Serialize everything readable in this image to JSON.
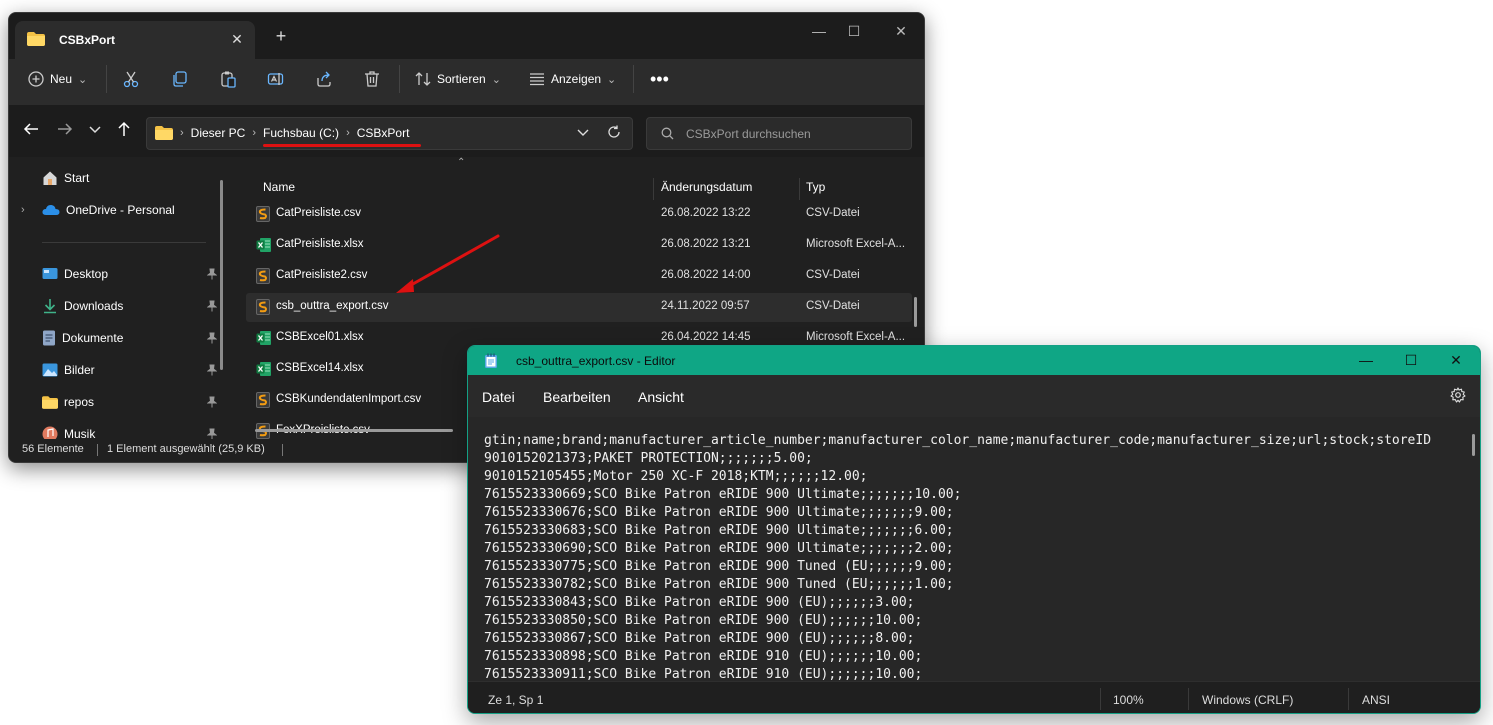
{
  "explorer": {
    "tab_title": "CSBxPort",
    "toolbar": {
      "new_label": "Neu",
      "sort_label": "Sortieren",
      "view_label": "Anzeigen"
    },
    "address": {
      "crumbs": [
        "Dieser PC",
        "Fuchsbau (C:)",
        "CSBxPort"
      ]
    },
    "search": {
      "placeholder": "CSBxPort durchsuchen"
    },
    "sidebar": {
      "items": [
        {
          "label": "Start",
          "icon": "home-icon"
        },
        {
          "label": "OneDrive - Personal",
          "icon": "cloud-icon"
        },
        {
          "label": "Desktop",
          "icon": "desktop-icon"
        },
        {
          "label": "Downloads",
          "icon": "download-icon"
        },
        {
          "label": "Dokumente",
          "icon": "document-icon"
        },
        {
          "label": "Bilder",
          "icon": "picture-icon"
        },
        {
          "label": "repos",
          "icon": "folder-icon"
        },
        {
          "label": "Musik",
          "icon": "music-icon"
        }
      ]
    },
    "columns": {
      "name": "Name",
      "date": "Änderungsdatum",
      "type": "Typ"
    },
    "files": [
      {
        "name": "CatPreisliste.csv",
        "date": "26.08.2022 13:22",
        "type": "CSV-Datei",
        "icon": "csv-icon"
      },
      {
        "name": "CatPreisliste.xlsx",
        "date": "26.08.2022 13:21",
        "type": "Microsoft Excel-A...",
        "icon": "excel-icon"
      },
      {
        "name": "CatPreisliste2.csv",
        "date": "26.08.2022 14:00",
        "type": "CSV-Datei",
        "icon": "csv-icon"
      },
      {
        "name": "csb_outtra_export.csv",
        "date": "24.11.2022 09:57",
        "type": "CSV-Datei",
        "icon": "csv-icon"
      },
      {
        "name": "CSBExcel01.xlsx",
        "date": "26.04.2022 14:45",
        "type": "Microsoft Excel-A...",
        "icon": "excel-icon"
      },
      {
        "name": "CSBExcel14.xlsx",
        "date": "",
        "type": "",
        "icon": "excel-icon"
      },
      {
        "name": "CSBKundendatenImport.csv",
        "date": "",
        "type": "",
        "icon": "csv-icon"
      },
      {
        "name": "FoxXPreisliste.csv",
        "date": "",
        "type": "",
        "icon": "csv-icon"
      }
    ],
    "status": {
      "count": "56 Elemente",
      "selection": "1 Element ausgewählt (25,9 KB)"
    }
  },
  "notepad": {
    "title": "csb_outtra_export.csv - Editor",
    "menu": [
      "Datei",
      "Bearbeiten",
      "Ansicht"
    ],
    "lines": [
      "gtin;name;brand;manufacturer_article_number;manufacturer_color_name;manufacturer_code;manufacturer_size;url;stock;storeID",
      "9010152021373;PAKET PROTECTION;;;;;;;5.00;",
      "9010152105455;Motor 250 XC-F 2018;KTM;;;;;;12.00;",
      "7615523330669;SCO Bike Patron eRIDE 900 Ultimate;;;;;;;10.00;",
      "7615523330676;SCO Bike Patron eRIDE 900 Ultimate;;;;;;;9.00;",
      "7615523330683;SCO Bike Patron eRIDE 900 Ultimate;;;;;;;6.00;",
      "7615523330690;SCO Bike Patron eRIDE 900 Ultimate;;;;;;;2.00;",
      "7615523330775;SCO Bike Patron eRIDE 900 Tuned (EU;;;;;;9.00;",
      "7615523330782;SCO Bike Patron eRIDE 900 Tuned (EU;;;;;;1.00;",
      "7615523330843;SCO Bike Patron eRIDE 900 (EU);;;;;;3.00;",
      "7615523330850;SCO Bike Patron eRIDE 900 (EU);;;;;;10.00;",
      "7615523330867;SCO Bike Patron eRIDE 900 (EU);;;;;;8.00;",
      "7615523330898;SCO Bike Patron eRIDE 910 (EU);;;;;;10.00;",
      "7615523330911;SCO Bike Patron eRIDE 910 (EU);;;;;;10.00;"
    ],
    "status": {
      "position": "Ze 1, Sp 1",
      "zoom": "100%",
      "line_ending": "Windows (CRLF)",
      "encoding": "ANSI"
    }
  },
  "colors": {
    "notepad_accent": "#0fa685",
    "annotation_red": "#d11111",
    "explorer_bg": "#202020"
  }
}
